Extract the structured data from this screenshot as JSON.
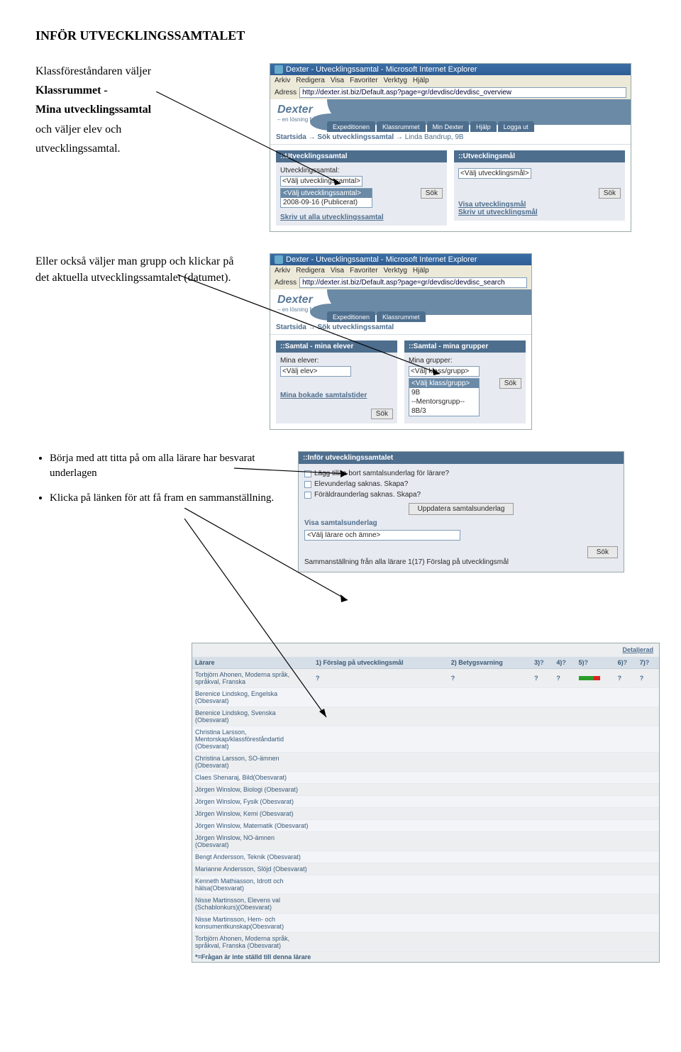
{
  "title": "INFÖR UTVECKLINGSSAMTALET",
  "para1": {
    "l1": "Klassföreståndaren väljer",
    "l2": "Klassrummet -",
    "l3": "Mina utvecklingssamtal",
    "l4": "och väljer elev och",
    "l5": "utvecklingssamtal."
  },
  "para2": "Eller också väljer man grupp och klickar på det aktuella utvecklingssamtalet (datumet).",
  "bullets": {
    "b1": "Börja med att titta på om alla lärare har besvarat underlagen",
    "b2": "Klicka på länken för att få fram en sammanställning."
  },
  "ie1": {
    "title": "Dexter - Utvecklingssamtal - Microsoft Internet Explorer",
    "menu": {
      "arkiv": "Arkiv",
      "redigera": "Redigera",
      "visa": "Visa",
      "favoriter": "Favoriter",
      "verktyg": "Verktyg",
      "hjalp": "Hjälp"
    },
    "addr_label": "Adress",
    "addr": "http://dexter.ist.biz/Default.asp?page=gr/devdisc/devdisc_overview",
    "logo_sub": "– en lösning från IST",
    "tabs": {
      "t1": "Expeditionen",
      "t2": "Klassrummet",
      "t3": "Min Dexter",
      "t4": "Hjälp",
      "t5": "Logga ut"
    },
    "crumb": {
      "c1": "Startsida",
      "arrow": "→",
      "c2": "Sök utvecklingssamtal",
      "arrow2": "→",
      "c3": "Linda Bandrup, 9B"
    },
    "panelL": {
      "head": "::Utvecklingssamtal",
      "label": "Utvecklingssamtal:",
      "sel": "<Välj utvecklingssamtal>",
      "opt1": "<Välj utvecklingssamtal>",
      "opt2": "2008-09-16 (Publicerat)",
      "sok": "Sök",
      "link": "Skriv ut alla utvecklingssamtal"
    },
    "panelR": {
      "head": "::Utvecklingsmål",
      "sel": "<Välj utvecklingsmål>",
      "sok": "Sök",
      "link1": "Visa utvecklingsmål",
      "link2": "Skriv ut utvecklingsmål"
    }
  },
  "ie2": {
    "title": "Dexter - Utvecklingssamtal - Microsoft Internet Explorer",
    "addr": "http://dexter.ist.biz/Default.asp?page=gr/devdisc/devdisc_search",
    "tabs": {
      "t1": "Expeditionen",
      "t2": "Klassrummet"
    },
    "crumb": {
      "c1": "Startsida",
      "arrow": "→",
      "c2": "Sök utvecklingssamtal"
    },
    "panelL": {
      "head": "::Samtal - mina elever",
      "label": "Mina elever:",
      "sel": "<Välj elev>",
      "link": "Mina bokade samtalstider",
      "sok": "Sök"
    },
    "panelR": {
      "head": "::Samtal - mina grupper",
      "label": "Mina grupper:",
      "sel": "<Välj klass/grupp>",
      "opt1": "<Välj klass/grupp>",
      "opt2": "9B",
      "opt3": "--Mentorsgrupp--",
      "opt4": "8B/3",
      "sok": "Sök"
    }
  },
  "ie3": {
    "head": "::Inför utvecklingssamtalet",
    "chk1": "Lägg till/ta bort samtalsunderlag för lärare?",
    "chk2": "Elevunderlag saknas. Skapa?",
    "chk3": "Föräldraunderlag saknas. Skapa?",
    "btn": "Uppdatera samtalsunderlag",
    "vis": "Visa samtalsunderlag",
    "sel": "<Välj lärare och ämne>",
    "sok": "Sök",
    "link1": "Sammanställning från alla lärare 1(17)",
    "link2": "Förslag på utvecklingsmål"
  },
  "table": {
    "detaljerad": "Detaljerad",
    "h_larare": "Lärare",
    "h1": "1) Förslag på utvecklingsmål",
    "h2": "2) Betygsvarning",
    "h3": "3)",
    "h4": "4)",
    "h5": "5)",
    "h6": "6)",
    "h7": "7)",
    "rows": [
      "Torbjörn Ahonen, Moderna språk, språkval, Franska",
      "Berenice Lindskog, Engelska (Obesvarat)",
      "Berenice Lindskog, Svenska (Obesvarat)",
      "Christina Larsson, Mentorskap/klassföreståndartid (Obesvarat)",
      "Christina Larsson, SO-ämnen (Obesvarat)",
      "Claes Shenaraj, Bild(Obesvarat)",
      "Jörgen Winslow, Biologi (Obesvarat)",
      "Jörgen Winslow, Fysik (Obesvarat)",
      "Jörgen Winslow, Kemi (Obesvarat)",
      "Jörgen Winslow, Matematik (Obesvarat)",
      "Jörgen Winslow, NO-ämnen (Obesvarat)",
      "Bengt Andersson, Teknik (Obesvarat)",
      "Marianne Andersson, Slöjd (Obesvarat)",
      "Kenneth Mathiasson, Idrott och hälsa(Obesvarat)",
      "Nisse Martinsson, Elevens val (Schablonkurs)(Obesvarat)",
      "Nisse Martinsson, Hem- och konsumentkunskap(Obesvarat)",
      "Torbjörn Ahonen, Moderna språk, språkval, Franska (Obesvarat)"
    ],
    "footnote": "*=Frågan är inte ställd till denna lärare"
  }
}
